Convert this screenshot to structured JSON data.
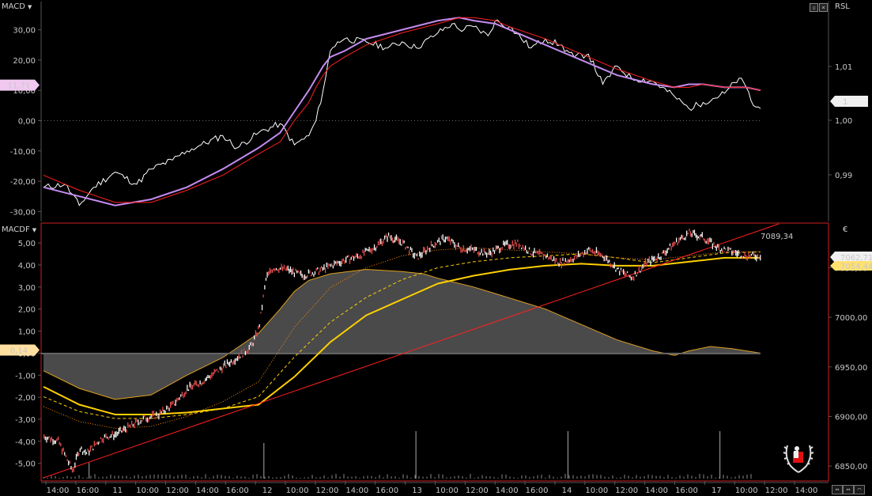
{
  "panels": {
    "top": {
      "title": "MACD",
      "right_title": "RSL"
    },
    "bottom": {
      "title": "MACDF",
      "right_title": "€"
    }
  },
  "colors": {
    "background": "#000000",
    "grid": "#555555",
    "white_line": "#ffffff",
    "violet_line": "#c48cf0",
    "red_line": "#ff2020",
    "yellow_line": "#ffd000",
    "orange_dotted": "#ff8a00",
    "gray_area": "#4a4a4a",
    "panel_border": "#cc2020"
  },
  "chart_data": [
    {
      "type": "line",
      "panel": "top",
      "title": "MACD",
      "ylim_left": [
        -32,
        38
      ],
      "y_ticks_left": [
        "30,00",
        "20,00",
        "10,00",
        "0,00",
        "-10,00",
        "-20,00",
        "-30,00"
      ],
      "y_ticks_right": [
        "1,01",
        "1,00",
        "0,99"
      ],
      "current_value_left": "11,71",
      "current_value_right": "1",
      "series": [
        {
          "color": "white",
          "x": [
            0,
            3,
            5,
            7,
            10,
            13,
            15,
            18,
            20,
            22,
            25,
            27,
            30,
            33,
            35,
            37,
            38,
            39,
            40,
            41,
            42,
            45,
            48,
            50,
            52,
            55,
            57,
            58,
            60,
            62,
            63,
            65,
            68,
            70,
            72,
            74,
            76,
            78,
            80,
            82,
            85,
            88,
            90,
            92,
            95,
            97,
            98,
            99,
            100
          ],
          "values": [
            -22,
            -21,
            -28,
            -22,
            -17,
            -21,
            -16,
            -13,
            -10,
            -8,
            -5,
            -9,
            -4,
            -1,
            -8,
            -5,
            0,
            10,
            23,
            26,
            27,
            26,
            24,
            26,
            24,
            29,
            32,
            30,
            31,
            28,
            33,
            31,
            24,
            27,
            25,
            21,
            22,
            12,
            18,
            14,
            13,
            8,
            4,
            6,
            9,
            14,
            11,
            5,
            4
          ]
        },
        {
          "color": "violet",
          "x": [
            0,
            5,
            10,
            15,
            20,
            25,
            30,
            33,
            35,
            37,
            38,
            39,
            40,
            42,
            45,
            50,
            55,
            58,
            60,
            63,
            65,
            70,
            75,
            80,
            85,
            88,
            90,
            92,
            95,
            98,
            100
          ],
          "values": [
            -22,
            -25,
            -28,
            -26,
            -22,
            -16,
            -9,
            -4,
            3,
            10,
            14,
            18,
            21,
            23,
            27,
            30,
            33,
            34,
            33,
            32,
            30,
            25,
            20,
            15,
            12,
            11,
            12,
            12,
            11,
            11,
            10
          ]
        },
        {
          "color": "red",
          "x": [
            0,
            5,
            10,
            15,
            20,
            25,
            30,
            33,
            35,
            37,
            38,
            39,
            40,
            42,
            45,
            50,
            55,
            58,
            60,
            63,
            65,
            70,
            75,
            80,
            85,
            88,
            90,
            92,
            95,
            98,
            100
          ],
          "values": [
            -18,
            -23,
            -27,
            -27,
            -23,
            -18,
            -11,
            -7,
            0,
            6,
            11,
            15,
            18,
            21,
            25,
            29,
            32,
            34,
            34,
            33,
            31,
            27,
            22,
            17,
            13,
            11,
            11,
            12,
            11,
            11,
            10
          ]
        }
      ]
    },
    {
      "type": "line",
      "panel": "bottom",
      "title": "MACDF",
      "ylim_left": [
        -5.8,
        5.9
      ],
      "y_ticks_left": [
        "5,00",
        "4,00",
        "3,00",
        "2,00",
        "1,00",
        "0,00",
        "-1,00",
        "-2,00",
        "-3,00",
        "-4,00",
        "-5,00"
      ],
      "y_ticks_right": [
        "7050,00",
        "7000,00",
        "6950,00",
        "6900,00",
        "6850,00"
      ],
      "current_value_left": "0,14",
      "price_labels": [
        "7089,34",
        "7062,71",
        "7054,44"
      ],
      "series": [
        {
          "name_role": "price",
          "color": "white",
          "x": [
            0,
            2,
            4,
            5,
            6,
            8,
            10,
            12,
            14,
            16,
            18,
            20,
            22,
            24,
            26,
            28,
            29,
            30,
            31,
            32,
            34,
            36,
            38,
            40,
            42,
            44,
            46,
            48,
            50,
            52,
            54,
            56,
            58,
            60,
            62,
            64,
            66,
            68,
            70,
            72,
            74,
            76,
            78,
            80,
            82,
            84,
            86,
            88,
            90,
            92,
            94,
            96,
            98,
            100
          ],
          "values": [
            6880,
            6875,
            6845,
            6868,
            6863,
            6878,
            6882,
            6890,
            6898,
            6902,
            6912,
            6928,
            6935,
            6945,
            6955,
            6965,
            6972,
            6990,
            7040,
            7050,
            7048,
            7042,
            7046,
            7052,
            7058,
            7062,
            7070,
            7082,
            7075,
            7060,
            7072,
            7080,
            7070,
            7068,
            7064,
            7072,
            7075,
            7065,
            7062,
            7055,
            7060,
            7068,
            7062,
            7048,
            7040,
            7055,
            7062,
            7075,
            7085,
            7080,
            7070,
            7066,
            7062,
            7062
          ]
        },
        {
          "name_role": "gray_area",
          "color": "gray",
          "x": [
            0,
            5,
            10,
            15,
            20,
            25,
            30,
            33,
            35,
            37,
            40,
            45,
            50,
            53,
            55,
            60,
            65,
            70,
            75,
            80,
            85,
            88,
            90,
            93,
            96,
            100
          ],
          "values": [
            -0.8,
            -1.6,
            -2.1,
            -1.9,
            -1.0,
            -0.2,
            0.9,
            2.0,
            2.8,
            3.3,
            3.6,
            3.8,
            3.7,
            3.6,
            3.4,
            3.0,
            2.5,
            2.0,
            1.3,
            0.6,
            0.1,
            -0.1,
            0.1,
            0.3,
            0.2,
            0.0
          ]
        },
        {
          "name_role": "yellow_ma",
          "color": "yellow",
          "x": [
            0,
            5,
            10,
            15,
            20,
            25,
            30,
            35,
            40,
            45,
            50,
            55,
            60,
            65,
            70,
            75,
            80,
            85,
            90,
            95,
            100
          ],
          "values": [
            6930,
            6912,
            6902,
            6902,
            6904,
            6908,
            6912,
            6940,
            6975,
            7002,
            7018,
            7034,
            7042,
            7048,
            7052,
            7054,
            7052,
            7052,
            7056,
            7060,
            7060
          ]
        },
        {
          "name_role": "dashed_ma",
          "color": "yellow_dashed",
          "x": [
            0,
            5,
            10,
            15,
            20,
            25,
            30,
            35,
            40,
            45,
            50,
            55,
            60,
            65,
            70,
            75,
            80,
            85,
            90,
            95,
            100
          ],
          "values": [
            6920,
            6905,
            6898,
            6898,
            6902,
            6908,
            6920,
            6960,
            6995,
            7020,
            7038,
            7050,
            7056,
            7060,
            7062,
            7064,
            7060,
            7055,
            7060,
            7065,
            7066
          ]
        },
        {
          "name_role": "orange_dotted_ma",
          "color": "orange_dotted",
          "x": [
            0,
            5,
            10,
            15,
            20,
            25,
            30,
            35,
            40,
            45,
            50,
            55,
            60,
            65,
            70,
            75,
            80,
            85,
            90,
            95,
            100
          ],
          "values": [
            6910,
            6895,
            6888,
            6890,
            6900,
            6915,
            6935,
            6990,
            7030,
            7050,
            7062,
            7068,
            7070,
            7068,
            7066,
            7064,
            7060,
            7058,
            7062,
            7066,
            7066
          ]
        },
        {
          "name_role": "trendline",
          "color": "red",
          "x": [
            0,
            100
          ],
          "values": [
            6843,
            7085
          ]
        }
      ]
    }
  ],
  "x_axis": {
    "ticks": [
      "14:00",
      "16:00",
      "11",
      "10:00",
      "12:00",
      "14:00",
      "16:00",
      "12",
      "10:00",
      "12:00",
      "14:00",
      "16:00",
      "13",
      "10:00",
      "12:00",
      "14:00",
      "16:00",
      "14",
      "10:00",
      "12:00",
      "14:00",
      "16:00",
      "17",
      "10:00",
      "12:00",
      "14:00"
    ]
  },
  "icons": {
    "window_min": "minimize-icon",
    "window_close": "close-icon",
    "nav": [
      "scroll-left-icon",
      "scroll-right-icon",
      "chart-type-icon"
    ],
    "logo": "laurel-logo-icon"
  }
}
